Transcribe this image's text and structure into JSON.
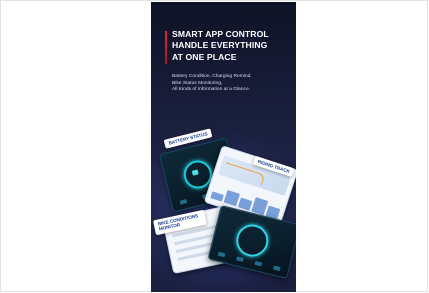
{
  "poster": {
    "headline_lines": [
      "SMART APP CONTROL",
      "HANDLE EVERYTHING",
      "AT ONE PLACE"
    ],
    "feature_lines": [
      "Battery Condition, Charging Remind,",
      "Bike Status Monitoring,",
      "All Kinds of Information at a Glance."
    ],
    "labels": {
      "battery": "BATTERY STATUS",
      "riding": "RIDING TRACK",
      "bike": "BIKE CONDITIONS MONITOR"
    }
  },
  "colors": {
    "accent": "#e8233a",
    "background": "#181d3a",
    "highlight": "#1ec9d6"
  }
}
